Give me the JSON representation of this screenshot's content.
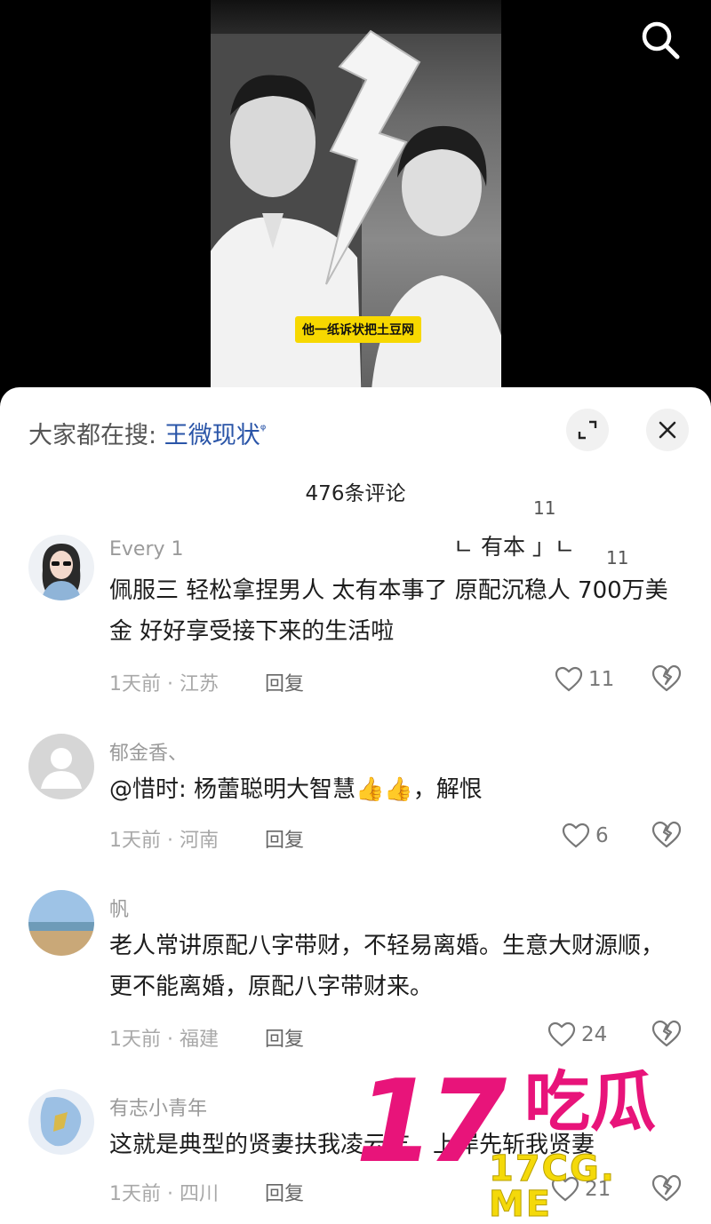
{
  "video": {
    "caption": "他一纸诉状把土豆网",
    "icons": {
      "search": "search-icon"
    }
  },
  "sheet": {
    "hot_search_label": "大家都在搜:",
    "hot_search_term": "王微现状",
    "hot_search_icon": "ᵠ",
    "comment_count_title": "476条评论",
    "icons": {
      "expand": "expand-icon",
      "close": "close-icon",
      "like": "heart-icon",
      "dislike": "broken-heart-icon"
    }
  },
  "floating": {
    "text": "ㄴ 有本 」ㄴ",
    "num_a": "11",
    "num_b": "11"
  },
  "comments": [
    {
      "username": "Every 1",
      "content": "佩服三 轻松拿捏男人 太有本事了 原配沉稳人 700万美金 好好享受接下来的生活啦",
      "time_location": "1天前 · 江苏",
      "reply": "回复",
      "likes": "11"
    },
    {
      "username": "郁金香、",
      "content": "@惜时: 杨蕾聪明大智慧👍👍，解恨",
      "time_location": "1天前 · 河南",
      "reply": "回复",
      "likes": "6"
    },
    {
      "username": "帆",
      "content": "老人常讲原配八字带财，不轻易离婚。生意大财源顺，更不能离婚，原配八字带财来。",
      "time_location": "1天前 · 福建",
      "reply": "回复",
      "likes": "24"
    },
    {
      "username": "有志小青年",
      "content": "这就是典型的贤妻扶我凌云志，上岸先斩我贤妻",
      "time_location": "1天前 · 四川",
      "reply": "回复",
      "likes": "21"
    }
  ],
  "watermark": {
    "number": "17",
    "chinese": "吃瓜",
    "url": "17CG. ME"
  }
}
